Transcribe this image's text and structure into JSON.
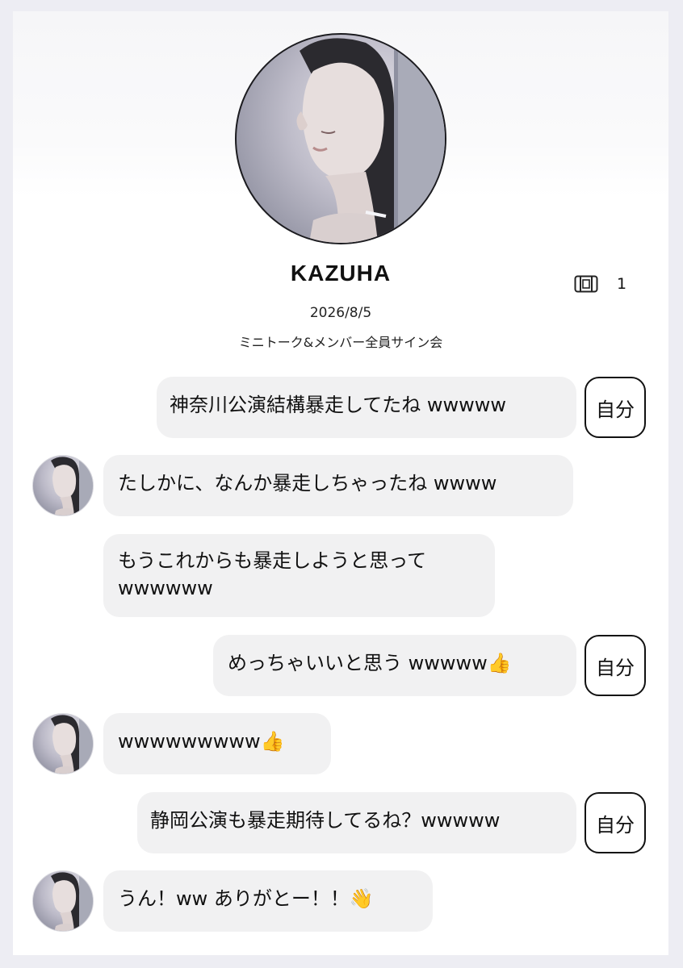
{
  "profile": {
    "name": "KAZUHA",
    "ticket_icon": "ticket-icon",
    "ticket_count": "1",
    "event_date": "2026/8/5",
    "event_title": "ミニトーク&メンバー全員サイン会"
  },
  "self_tag_label": "自分",
  "messages": [
    {
      "sender": "self",
      "text": "神奈川公演結構暴走してたね wwwww"
    },
    {
      "sender": "member",
      "text": "たしかに、なんか暴走しちゃったね wwww"
    },
    {
      "sender": "member",
      "text": "もうこれからも暴走しようと思って wwwwww"
    },
    {
      "sender": "self",
      "text": "めっちゃいいと思う wwwww👍"
    },
    {
      "sender": "member",
      "text": "wwwwwwwww👍"
    },
    {
      "sender": "self",
      "text": "静岡公演も暴走期待してるね？wwwww"
    },
    {
      "sender": "member",
      "text": "うん！ww ありがとー！！👋"
    }
  ]
}
